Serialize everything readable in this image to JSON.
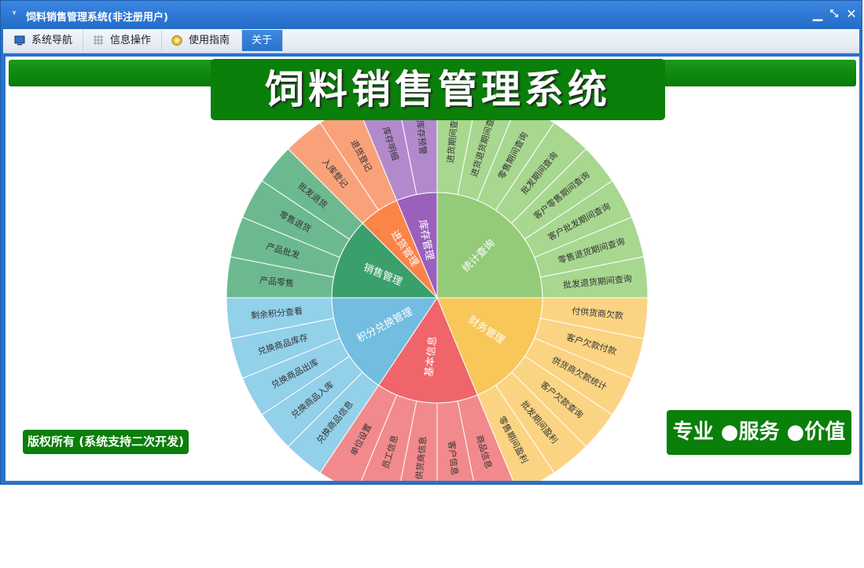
{
  "window": {
    "title": "饲料销售管理系统(非注册用户)",
    "icon": "app-logo-icon",
    "controls": [
      "minimize-icon",
      "restore-icon",
      "close-icon"
    ],
    "accent_color": "#2a72cc"
  },
  "tabs": [
    {
      "label": "系统导航",
      "icon": "monitor-icon"
    },
    {
      "label": "信息操作",
      "icon": "grid-icon"
    },
    {
      "label": "使用指南",
      "icon": "guide-icon"
    },
    {
      "label": "关于",
      "icon": "",
      "active": true
    }
  ],
  "main": {
    "title": "饲料销售管理系统",
    "copyright": "版权所有 (系统支持二次开发)",
    "slogan": "专业 ●服务 ●价值",
    "banner_color": "#0a7f0a"
  },
  "sunburst": {
    "groups": [
      {
        "name": "统计查询",
        "color": "#93cb79",
        "outer_color": "#a8d790",
        "items": [
          "进货期间查询",
          "进货退货期间查询",
          "零售期间查询",
          "批发期间查询",
          "客户零售期间查询",
          "客户批发期间查询",
          "零售退货期间查询",
          "批发退货期间查询"
        ]
      },
      {
        "name": "财务管理",
        "color": "#f8c75a",
        "outer_color": "#fbd483",
        "items": [
          "付供货商欠款",
          "客户欠款付款",
          "供货商欠款统计",
          "客户欠款查询",
          "批发期间盈利",
          "零售期间盈利"
        ]
      },
      {
        "name": "基本信息",
        "color": "#ef656a",
        "outer_color": "#f28a8d",
        "items": [
          "商品信息",
          "客户信息",
          "供货商信息",
          "员工信息",
          "单位设置"
        ]
      },
      {
        "name": "积分兑换管理",
        "color": "#72bde0",
        "outer_color": "#93d0ea",
        "items": [
          "兑换商品信息",
          "兑换商品入库",
          "兑换商品出库",
          "兑换商品库存",
          "剩余积分查看"
        ]
      },
      {
        "name": "销售管理",
        "color": "#3b9f6c",
        "outer_color": "#6cb990",
        "items": [
          "产品零售",
          "产品批发",
          "零售退货",
          "批发退货"
        ]
      },
      {
        "name": "进货管理",
        "color": "#fb8449",
        "outer_color": "#f9a27a",
        "items": [
          "入库登记",
          "退货登记"
        ]
      },
      {
        "name": "库存管理",
        "color": "#9b5fbc",
        "outer_color": "#b28acc",
        "items": [
          "库存明细",
          "库存预警"
        ]
      }
    ]
  }
}
